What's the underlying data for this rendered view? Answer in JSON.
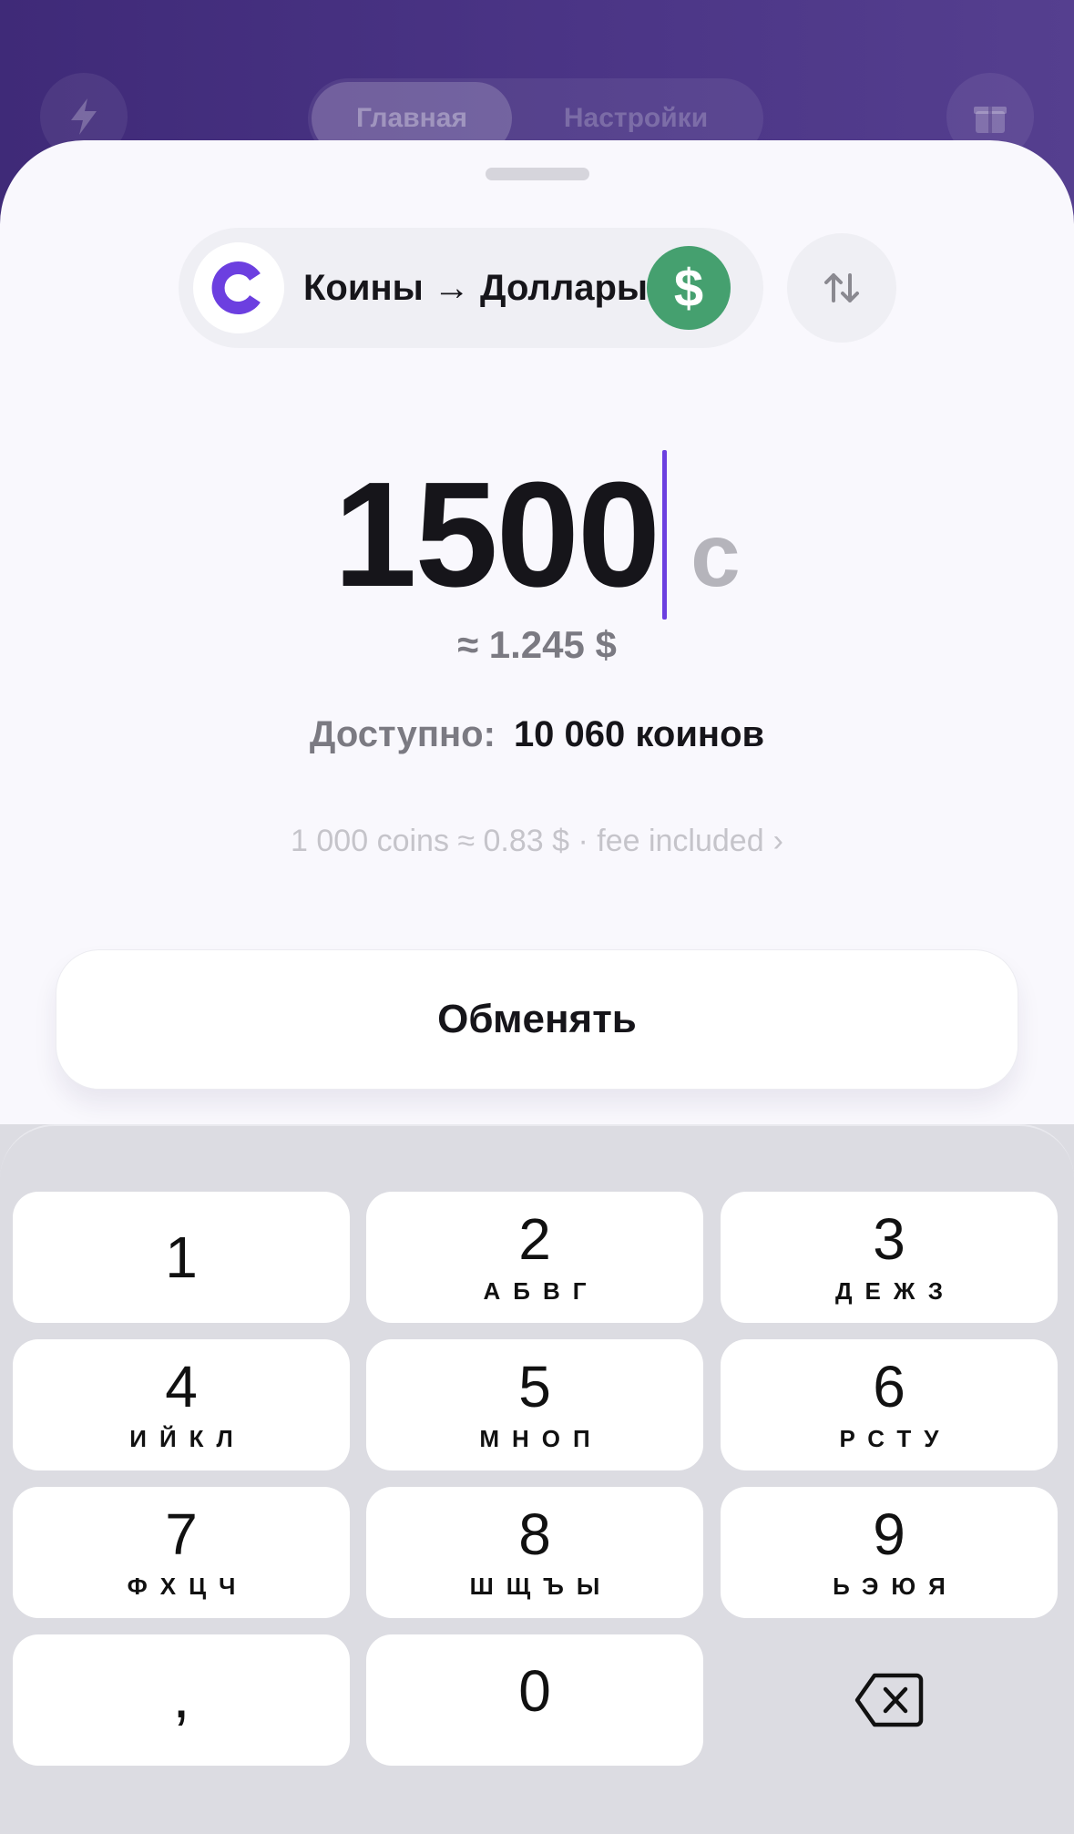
{
  "background": {
    "tabs": [
      "Главная",
      "Настройки"
    ],
    "left_icon": "lightning-icon",
    "right_icon": "gift-icon"
  },
  "pair": {
    "label": "Коины → Доллары",
    "coin_symbol": "C",
    "dollar_symbol": "$",
    "coin_color": "#6c3fe0",
    "dollar_color": "#45a06f"
  },
  "amount": {
    "value": "1500",
    "unit": "c",
    "approx": "≈ 1.245 $"
  },
  "available": {
    "label": "Доступно:",
    "value": "10 060 коинов"
  },
  "rate": {
    "text": "1 000 coins ≈ 0.83 $ · fee included",
    "chevron": "›"
  },
  "exchange_button": {
    "label": "Обменять"
  },
  "keypad": {
    "keys": [
      {
        "digit": "1",
        "letters": ""
      },
      {
        "digit": "2",
        "letters": "АБВГ"
      },
      {
        "digit": "3",
        "letters": "ДЕЖЗ"
      },
      {
        "digit": "4",
        "letters": "ИЙКЛ"
      },
      {
        "digit": "5",
        "letters": "МНОП"
      },
      {
        "digit": "6",
        "letters": "РСТУ"
      },
      {
        "digit": "7",
        "letters": "ФХЦЧ"
      },
      {
        "digit": "8",
        "letters": "ШЩЪЫ"
      },
      {
        "digit": "9",
        "letters": "ЬЭЮЯ"
      }
    ],
    "comma": ",",
    "zero": "0",
    "backspace_icon": "backspace-icon"
  }
}
